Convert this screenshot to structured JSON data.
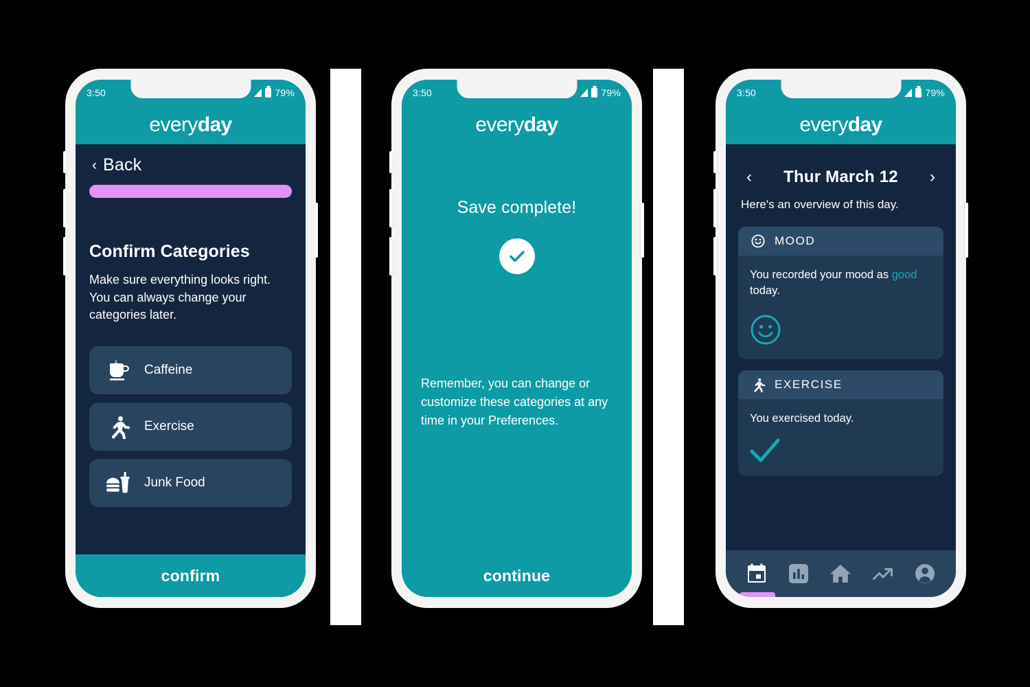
{
  "colors": {
    "teal": "#0E9BA5",
    "navy": "#14263F",
    "card": "#28445F",
    "card_body": "#203A54",
    "card_head": "#2D4A68",
    "purple": "#DE93F5",
    "accent": "#17A8B3",
    "tab_inactive": "#93A5B8"
  },
  "status": {
    "time": "3:50",
    "battery": "79%",
    "signal_icon": "signal-triangle-icon",
    "battery_icon": "battery-icon"
  },
  "brand": {
    "thin": "every",
    "bold": "day"
  },
  "screen1": {
    "back_chevron": "‹",
    "back_label": "Back",
    "progress_percent": 100,
    "heading": "Confirm Categories",
    "subtext": "Make sure everything looks right. You can always change your categories later.",
    "categories": [
      {
        "label": "Caffeine",
        "icon": "coffee-cup-icon"
      },
      {
        "label": "Exercise",
        "icon": "running-person-icon"
      },
      {
        "label": "Junk Food",
        "icon": "burger-drink-icon"
      }
    ],
    "confirm_label": "confirm"
  },
  "screen2": {
    "title": "Save complete!",
    "check_icon": "check-circle-icon",
    "reminder": "Remember, you can change or customize these categories at any time in your Preferences.",
    "continue_label": "continue"
  },
  "screen3": {
    "prev_arrow": "‹",
    "date_label": "Thur March 12",
    "next_arrow": "›",
    "overview_text": "Here's an overview of this day.",
    "cards": [
      {
        "title": "MOOD",
        "icon": "smiley-face-icon",
        "text_before": "You recorded your mood as ",
        "text_accent": "good",
        "text_after": " today.",
        "visual": "smiley-face-large-icon"
      },
      {
        "title": "EXERCISE",
        "icon": "running-person-icon",
        "text_before": "You exercised today.",
        "text_accent": "",
        "text_after": "",
        "visual": "checkmark-large-icon"
      }
    ],
    "tabs": [
      {
        "name": "calendar",
        "icon": "calendar-icon",
        "active": true
      },
      {
        "name": "stats",
        "icon": "bar-chart-icon",
        "active": false
      },
      {
        "name": "home",
        "icon": "home-icon",
        "active": false
      },
      {
        "name": "trends",
        "icon": "trending-up-icon",
        "active": false
      },
      {
        "name": "profile",
        "icon": "user-avatar-icon",
        "active": false
      }
    ]
  }
}
